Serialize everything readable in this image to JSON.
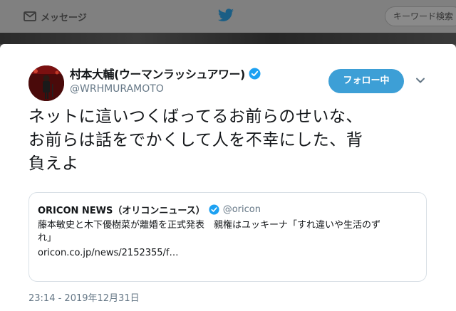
{
  "nav": {
    "messages_label": "メッセージ",
    "search_placeholder": "キーワード検索"
  },
  "tweet": {
    "display_name": "村本大輔(ウーマンラッシュアワー)",
    "handle": "@WRHMURAMOTO",
    "verified": true,
    "follow_label": "フォロー中",
    "text_lines": [
      "ネットに這いつくばってるお前らのせいな、",
      "お前らは話をでかくして人を不幸にした、背",
      "負えよ"
    ],
    "timestamp": "23:14 - 2019年12月31日"
  },
  "quote": {
    "name": "ORICON NEWS（オリコンニュース）",
    "handle": "@oricon",
    "verified": true,
    "body_lines": [
      "藤本敏史と木下優樹菜が離婚を正式発表　親権はユッキーナ「すれ違いや生活のず",
      "れ」"
    ],
    "link": "oricon.co.jp/news/2152355/f…"
  },
  "colors": {
    "accent": "#3d9fd6",
    "verified": "#1da1f2",
    "secondary_text": "#657786",
    "border": "#d9e0e6"
  }
}
